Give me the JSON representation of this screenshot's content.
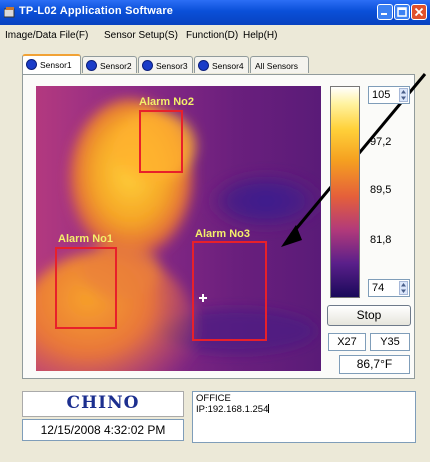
{
  "window": {
    "title": "TP-L02 Application Software",
    "accent_color": "#0a4fd8"
  },
  "menu": [
    {
      "label": "Image/Data File(F)"
    },
    {
      "label": "Sensor Setup(S)"
    },
    {
      "label": "Function(D)"
    },
    {
      "label": "Help(H)"
    }
  ],
  "tabs": [
    {
      "label": "Sensor1",
      "active": true,
      "icon": "blue-circle-icon"
    },
    {
      "label": "Sensor2",
      "active": false,
      "icon": "blue-circle-icon"
    },
    {
      "label": "Sensor3",
      "active": false,
      "icon": "blue-circle-icon"
    },
    {
      "label": "Sensor4",
      "active": false,
      "icon": "blue-circle-icon"
    },
    {
      "label": "All Sensors",
      "active": false
    }
  ],
  "thermal": {
    "alarms": [
      {
        "label": "Alarm No2"
      },
      {
        "label": "Alarm No1"
      },
      {
        "label": "Alarm No3"
      }
    ],
    "alarm_color": "#e8202a",
    "label_color": "#f4f06a"
  },
  "scale": {
    "max_value": "105",
    "ticks": [
      "97,2",
      "89,5",
      "81,8"
    ],
    "min_value": "74"
  },
  "controls": {
    "stop_label": "Stop",
    "x_readout": "X27",
    "y_readout": "Y35",
    "temperature": "86,7°F"
  },
  "footer": {
    "logo": "CHINO",
    "datetime": "12/15/2008 4:32:02 PM",
    "info_line1": "OFFICE",
    "info_line2": "IP:192.168.1.254"
  }
}
